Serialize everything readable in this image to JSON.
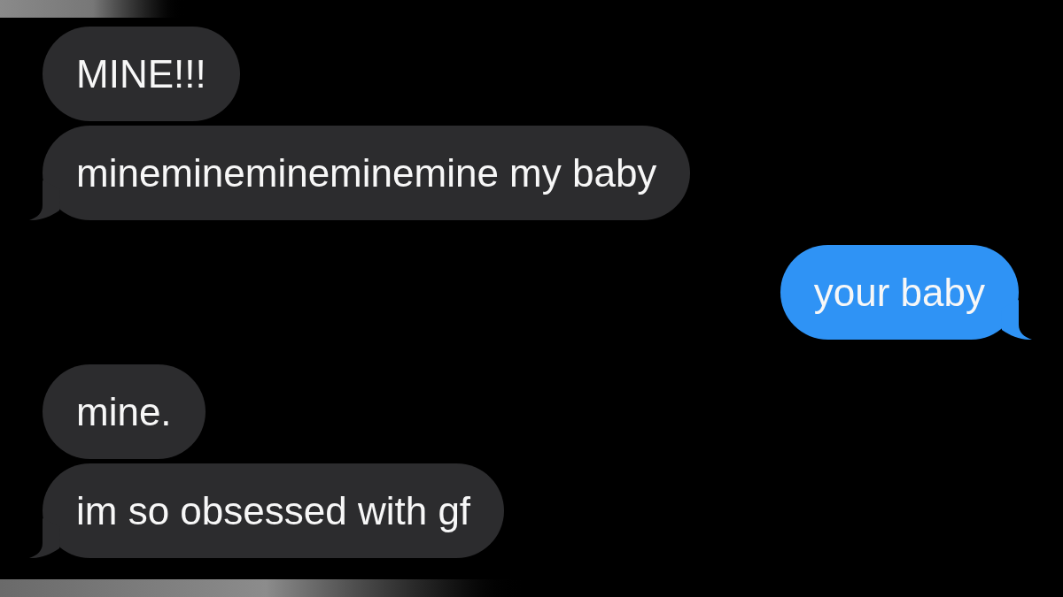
{
  "messages": [
    {
      "kind": "received",
      "text": "MINE!!!",
      "tail": false
    },
    {
      "kind": "received",
      "text": "mineminemineminemine my baby",
      "tail": true
    },
    {
      "kind": "sent",
      "text": "your baby",
      "tail": true
    },
    {
      "kind": "received",
      "text": "mine.",
      "tail": false
    },
    {
      "kind": "received",
      "text": "im so obsessed with gf",
      "tail": true
    }
  ]
}
